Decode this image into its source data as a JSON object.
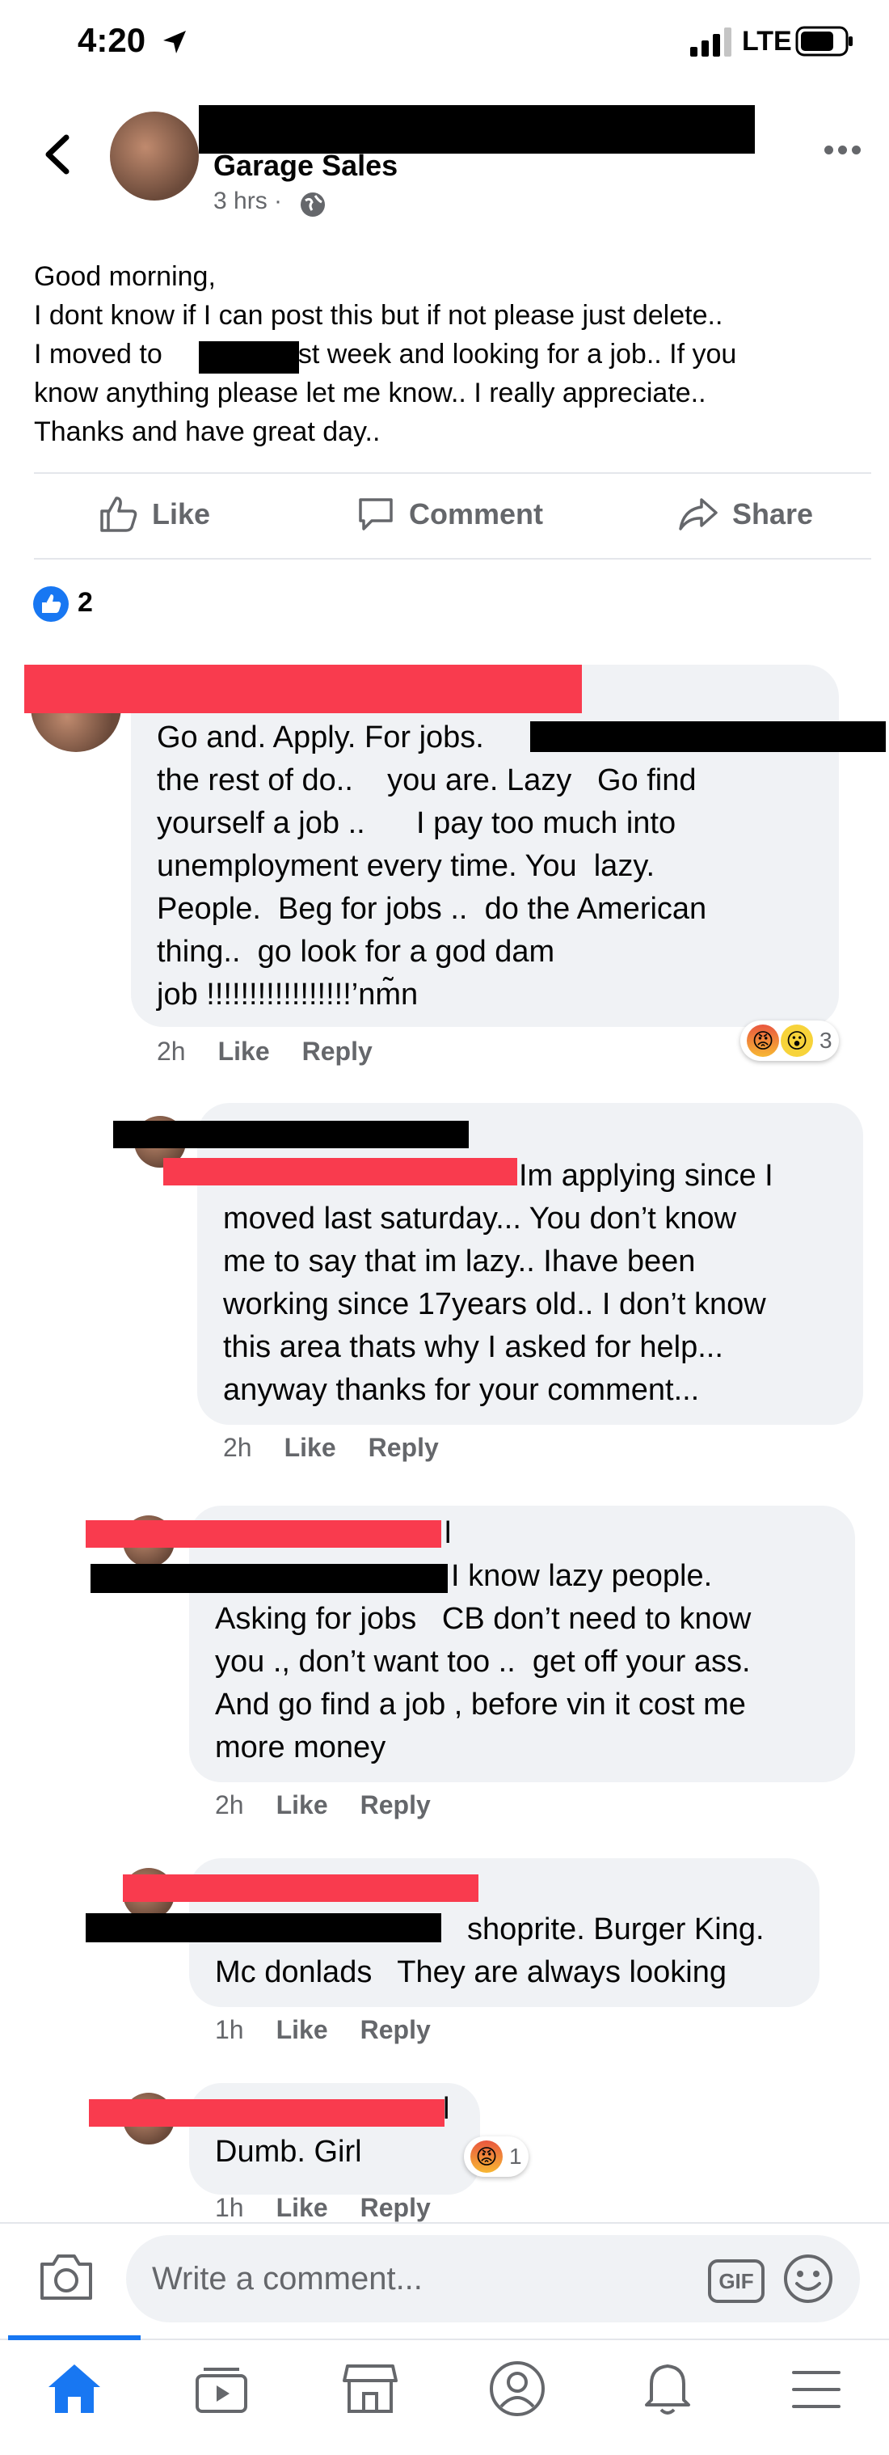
{
  "status": {
    "time": "4:20",
    "network": "LTE"
  },
  "post": {
    "group": "Garage Sales",
    "meta": "3 hrs ·",
    "body_lines": [
      "Good morning,",
      "I dont know if I can post this but if not please just delete..",
      "I moved to               last week and looking for a job.. If you",
      "know anything please let me know.. I really appreciate..",
      "Thanks and have great day.."
    ],
    "actions": {
      "like": "Like",
      "comment": "Comment",
      "share": "Share"
    },
    "reaction_count": "2"
  },
  "comments": [
    {
      "lines": [
        "Go and. Apply. For jobs.",
        "the rest of do..    you are. Lazy   Go find",
        "yourself a job ..      I pay too much into",
        "unemployment every time. You  lazy.",
        "People.  Beg for jobs ..  do the American",
        "thing..  go look for a god dam",
        "job !!!!!!!!!!!!!!!!!’nm̃n"
      ],
      "time": "2h",
      "like": "Like",
      "reply": "Reply",
      "reaction_count": "3"
    },
    {
      "lines": [
        "Im applying since I",
        "moved last saturday... You don’t know",
        "me to say that im lazy.. Ihave been",
        "working since 17years old.. I don’t know",
        "this area thats why I asked for help...",
        "anyway thanks for your comment..."
      ],
      "time": "2h",
      "like": "Like",
      "reply": "Reply"
    },
    {
      "lines": [
        "l",
        "I know lazy people.",
        "Asking for jobs   CB don’t need to know",
        "you ., don’t want too ..  get off your ass.",
        "And go find a job , before vin it cost me",
        "more money"
      ],
      "time": "2h",
      "like": "Like",
      "reply": "Reply"
    },
    {
      "lines": [
        "shoprite. Burger King.",
        "Mc donlads   They are always looking"
      ],
      "time": "1h",
      "like": "Like",
      "reply": "Reply"
    },
    {
      "lines": [
        "l",
        "Dumb. Girl"
      ],
      "time": "1h",
      "like": "Like",
      "reply": "Reply",
      "reaction_count": "1"
    }
  ],
  "composer": {
    "placeholder": "Write a comment...",
    "gif": "GIF"
  },
  "colors": {
    "accent": "#1877f2",
    "redaction_red": "#f93b4e",
    "bubble": "#f0f2f5",
    "muted_text": "#65676b"
  },
  "tabs": [
    "home-icon",
    "watch-icon",
    "marketplace-icon",
    "profile-icon",
    "notifications-icon",
    "menu-icon"
  ]
}
